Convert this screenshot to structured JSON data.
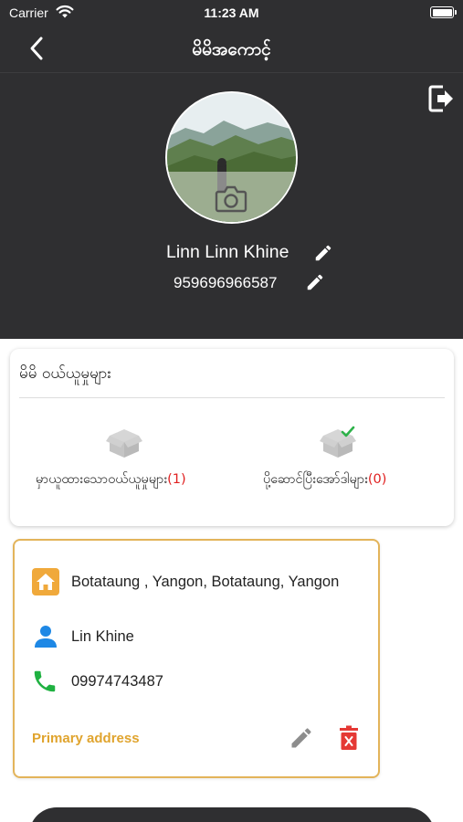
{
  "status_bar": {
    "carrier": "Carrier",
    "time": "11:23 AM"
  },
  "nav": {
    "title": "မိမိအကောင့်",
    "back_icon": "chevron-left-icon",
    "logout_icon": "logout-icon"
  },
  "profile": {
    "name": "Linn Linn Khine",
    "phone": "959696966587",
    "avatar_icon": "camera-icon"
  },
  "orders": {
    "title": "မိမိ ဝယ်ယူမှုများ",
    "items": [
      {
        "label": "မှာယူထားသောဝယ်ယူမှုများ",
        "count": "(1)",
        "icon": "box-icon"
      },
      {
        "label": "ပို့ဆောင်ပြီးအော်ဒါများ",
        "count": "(0)",
        "icon": "box-check-icon"
      }
    ]
  },
  "address": {
    "location": "Botataung , Yangon, Botataung, Yangon",
    "contact_name": "Lin Khine",
    "contact_phone": "09974743487",
    "primary_label": "Primary address"
  },
  "colors": {
    "header_bg": "#2f2f31",
    "accent_gold": "#e3b45a",
    "primary_label": "#e0a42e",
    "count_red": "#e02020",
    "delete_red": "#e53935",
    "phone_green": "#1fb141",
    "person_blue": "#1e88e5"
  }
}
